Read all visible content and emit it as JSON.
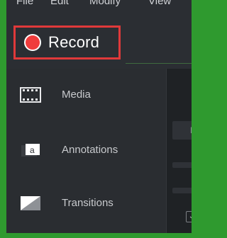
{
  "menubar": {
    "items": [
      "File",
      "Edit",
      "Modify",
      "View"
    ]
  },
  "header": {
    "record_label": "Record"
  },
  "sidebar": {
    "items": [
      {
        "label": "Media",
        "icon": "film-strip-icon"
      },
      {
        "label": "Annotations",
        "icon": "annotation-icon"
      },
      {
        "label": "Transitions",
        "icon": "transition-icon"
      }
    ]
  },
  "right_panel": {
    "partial_letter": "I",
    "chevron": "⌄"
  },
  "colors": {
    "frame_green": "#2f9a2f",
    "record_border": "#e0393a",
    "record_dot": "#f03c3c",
    "panel_bg": "#2a2d31"
  }
}
